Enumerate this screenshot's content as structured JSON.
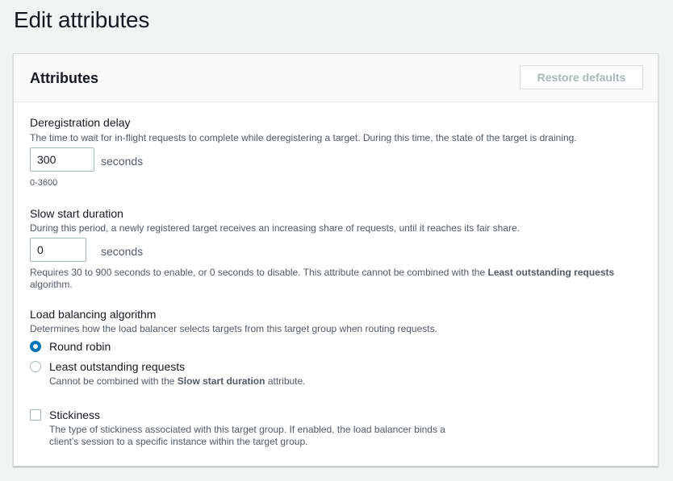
{
  "page": {
    "title": "Edit attributes"
  },
  "panel": {
    "title": "Attributes",
    "restore_label": "Restore defaults"
  },
  "deregistration": {
    "label": "Deregistration delay",
    "description": "The time to wait for in-flight requests to complete while deregistering a target. During this time, the state of the target is draining.",
    "value": "300",
    "unit": "seconds",
    "range_hint": "0-3600"
  },
  "slow_start": {
    "label": "Slow start duration",
    "description": "During this period, a newly registered target receives an increasing share of requests, until it reaches its fair share.",
    "value": "0",
    "unit": "seconds",
    "hint_prefix": "Requires 30 to 900 seconds to enable, or 0 seconds to disable. This attribute cannot be combined with the",
    "hint_bold": "Least outstanding requests",
    "hint_suffix": "algorithm."
  },
  "algorithm": {
    "label": "Load balancing algorithm",
    "description": "Determines how the load balancer selects targets from this target group when routing requests.",
    "selected": "Round robin",
    "options": [
      {
        "label": "Round robin"
      },
      {
        "label": "Least outstanding requests",
        "desc_prefix": "Cannot be combined with the",
        "desc_bold": "Slow start duration",
        "desc_suffix": "attribute."
      }
    ]
  },
  "stickiness": {
    "label": "Stickiness",
    "checked": false,
    "description_line1": "The type of stickiness associated with this target group. If enabled, the load balancer binds a",
    "description_line2": "client's session to a specific instance within the target group."
  },
  "colors": {
    "accent": "#0073bb",
    "background": "#f2f3f3",
    "border": "#aab7b8",
    "muted_text": "#545b64"
  }
}
